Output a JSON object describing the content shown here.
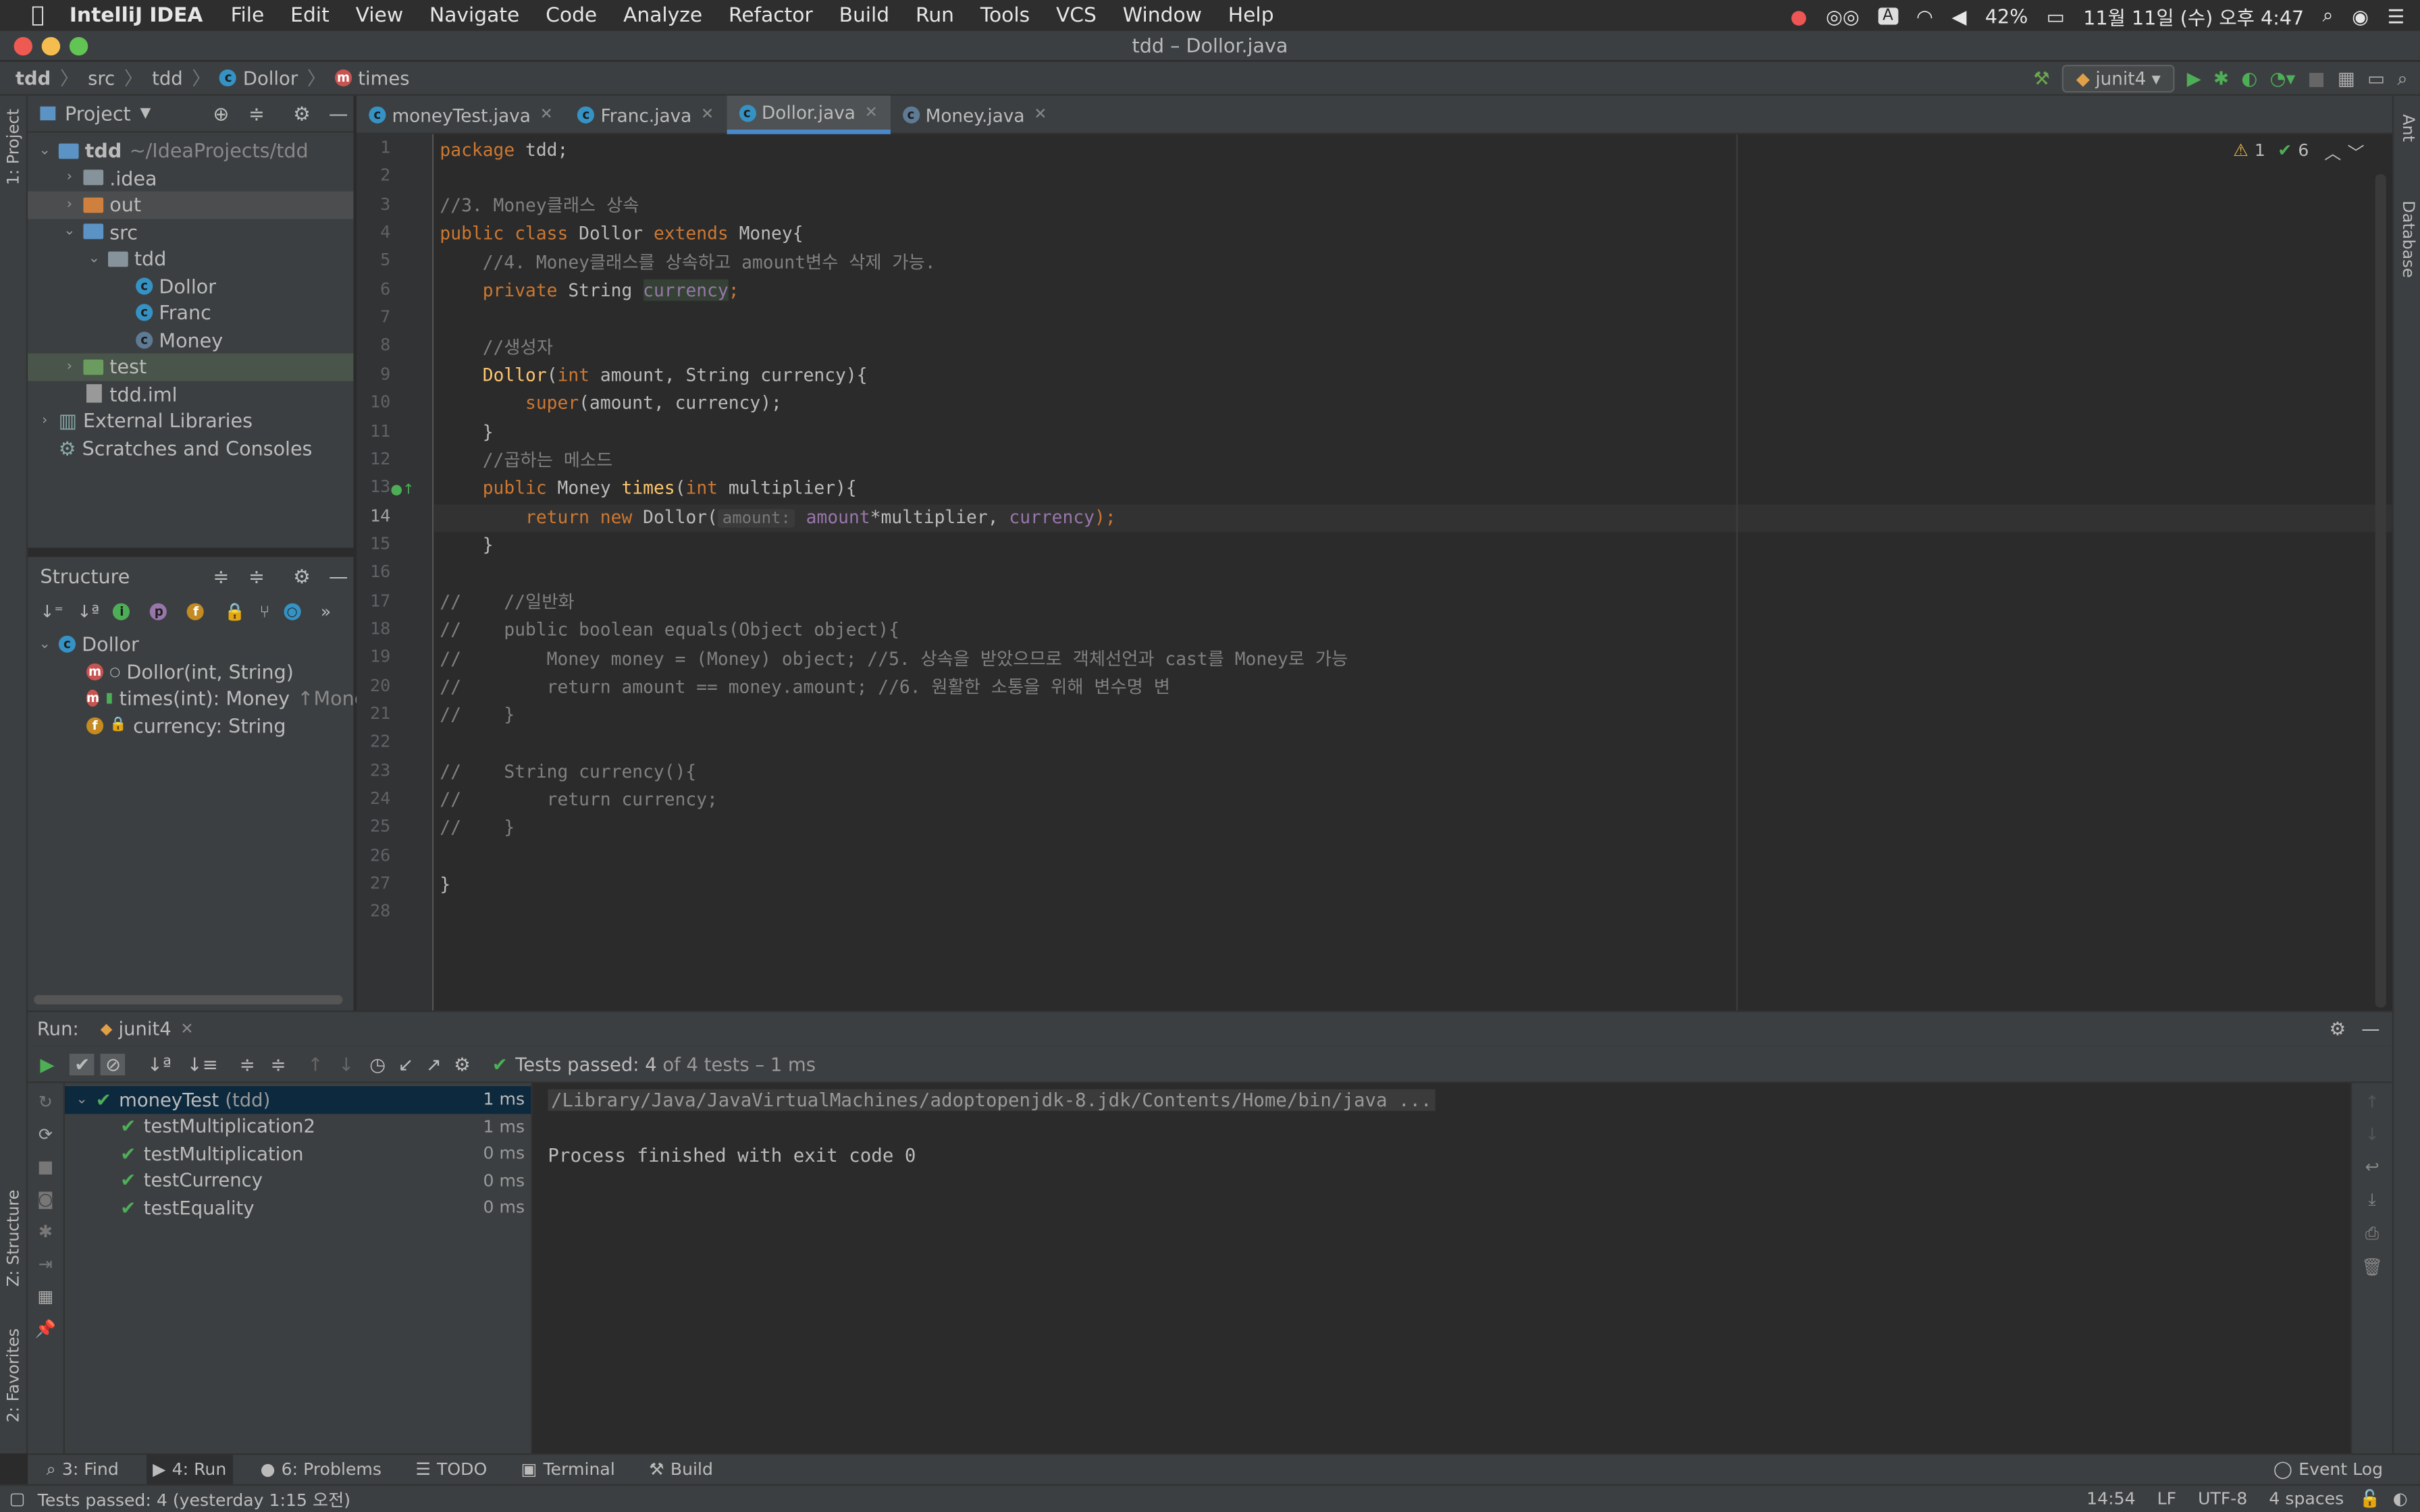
{
  "menubar": {
    "app": "IntelliJ IDEA",
    "items": [
      "File",
      "Edit",
      "View",
      "Navigate",
      "Code",
      "Analyze",
      "Refactor",
      "Build",
      "Run",
      "Tools",
      "VCS",
      "Window",
      "Help"
    ],
    "battery": "42%",
    "datetime": "11월 11일 (수) 오후 4:47"
  },
  "window": {
    "title": "tdd – Dollor.java"
  },
  "breadcrumbs": [
    "tdd",
    "src",
    "tdd",
    "Dollor",
    "times"
  ],
  "toolbar": {
    "run_config": "junit4"
  },
  "left_strip": {
    "project": "1: Project",
    "structure": "Z: Structure",
    "favorites": "2: Favorites"
  },
  "right_strip": {
    "ant": "Ant",
    "database": "Database"
  },
  "project": {
    "header": "Project",
    "items": [
      {
        "label": "tdd",
        "extra": "~/IdeaProjects/tdd"
      },
      {
        "label": ".idea"
      },
      {
        "label": "out"
      },
      {
        "label": "src"
      },
      {
        "label": "tdd"
      },
      {
        "label": "Dollor"
      },
      {
        "label": "Franc"
      },
      {
        "label": "Money"
      },
      {
        "label": "test"
      },
      {
        "label": "tdd.iml"
      },
      {
        "label": "External Libraries"
      },
      {
        "label": "Scratches and Consoles"
      }
    ]
  },
  "structure": {
    "header": "Structure",
    "items": [
      {
        "label": "Dollor"
      },
      {
        "label": "Dollor(int, String)"
      },
      {
        "label": "times(int): Money",
        "extra": "↑Money"
      },
      {
        "label": "currency: String"
      }
    ]
  },
  "tabs": [
    {
      "label": "moneyTest.java"
    },
    {
      "label": "Franc.java"
    },
    {
      "label": "Dollor.java"
    },
    {
      "label": "Money.java"
    }
  ],
  "editor": {
    "warnings": "1",
    "checks": "6",
    "hint_amount": "amount:",
    "line_numbers": [
      "1",
      "2",
      "3",
      "4",
      "5",
      "6",
      "7",
      "8",
      "9",
      "10",
      "11",
      "12",
      "13",
      "14",
      "15",
      "16",
      "17",
      "18",
      "19",
      "20",
      "21",
      "22",
      "23",
      "24",
      "25",
      "26",
      "27",
      "28"
    ],
    "code": {
      "l1a": "package",
      "l1b": " tdd;",
      "l3": "//3. Money클래스 상속",
      "l4a": "public class ",
      "l4b": "Dollor ",
      "l4c": "extends ",
      "l4d": "Money{",
      "l5": "    //4. Money클래스를 상속하고 amount변수 삭제 가능.",
      "l6a": "    private ",
      "l6b": "String ",
      "l6c": "currency",
      "l6d": ";",
      "l8": "    //생성자",
      "l9a": "    ",
      "l9b": "Dollor",
      "l9c": "(",
      "l9d": "int ",
      "l9e": "amount, String currency){",
      "l10a": "        ",
      "l10b": "super",
      "l10c": "(amount, currency);",
      "l11": "    }",
      "l12": "    //곱하는 메소드",
      "l13a": "    public ",
      "l13b": "Money ",
      "l13c": "times",
      "l13d": "(",
      "l13e": "int ",
      "l13f": "multiplier){",
      "l14a": "        return new ",
      "l14b": "Dollor(",
      "l14c": "amount",
      "l14d": "*multiplier, ",
      "l14e": "currency",
      "l14f": ");",
      "l15": "    }",
      "l17": "//    //일반화",
      "l18": "//    public boolean equals(Object object){",
      "l19": "//        Money money = (Money) object; //5. 상속을 받았으므로 객체선언과 cast를 Money로 가능",
      "l20": "//        return amount == money.amount; //6. 원활한 소통을 위해 변수명 변",
      "l21": "//    }",
      "l23": "//    String currency(){",
      "l24": "//        return currency;",
      "l25": "//    }",
      "l27": "}"
    }
  },
  "run": {
    "label": "Run:",
    "tab": "junit4",
    "status_prefix": "Tests passed: 4",
    "status_suffix": " of 4 tests – 1 ms",
    "tests": [
      {
        "name": "moneyTest",
        "pkg": "(tdd)",
        "time": "1 ms"
      },
      {
        "name": "testMultiplication2",
        "time": "1 ms"
      },
      {
        "name": "testMultiplication",
        "time": "0 ms"
      },
      {
        "name": "testCurrency",
        "time": "0 ms"
      },
      {
        "name": "testEquality",
        "time": "0 ms"
      }
    ],
    "console": [
      "/Library/Java/JavaVirtualMachines/adoptopenjdk-8.jdk/Contents/Home/bin/java ...",
      "Process finished with exit code 0"
    ]
  },
  "toolwindows": {
    "find": "3: Find",
    "run": "4: Run",
    "problems": "6: Problems",
    "todo": "TODO",
    "terminal": "Terminal",
    "build": "Build",
    "eventlog": "Event Log"
  },
  "statusbar": {
    "message": "Tests passed: 4 (yesterday 1:15 오전)",
    "position": "14:54",
    "line_sep": "LF",
    "encoding": "UTF-8",
    "indent": "4 spaces"
  },
  "colors": {
    "accent": "#4a88c7",
    "pass": "#4eae57",
    "keyword": "#cc7832"
  }
}
